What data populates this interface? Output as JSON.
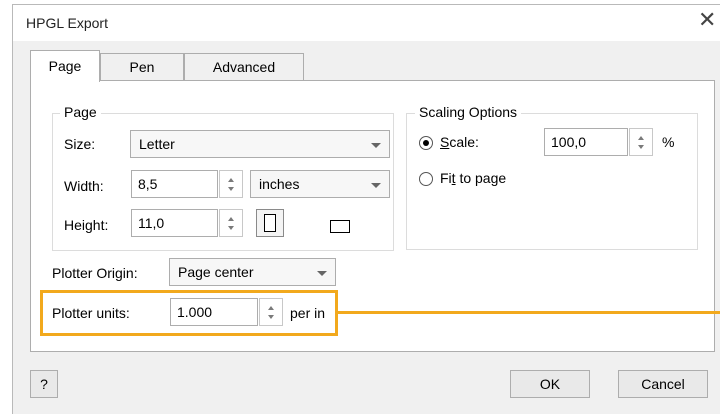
{
  "window": {
    "title": "HPGL Export",
    "close_glyph": "✕"
  },
  "tabs": [
    {
      "label": "Page",
      "active": true
    },
    {
      "label": "Pen",
      "active": false
    },
    {
      "label": "Advanced",
      "active": false
    }
  ],
  "page_group": {
    "title": "Page",
    "size_label": "Size:",
    "size_value": "Letter",
    "width_label": "Width:",
    "width_value": "8,5",
    "unit_value": "inches",
    "height_label": "Height:",
    "height_value": "11,0",
    "orientation": {
      "portrait_icon": "portrait-icon",
      "landscape_icon": "landscape-icon",
      "selected": "portrait"
    }
  },
  "scaling_group": {
    "title": "Scaling Options",
    "scale_label_key": "S",
    "scale_label_rest": "cale:",
    "scale_value": "100,0",
    "scale_unit": "%",
    "fit_label_pre": "Fi",
    "fit_label_key": "t",
    "fit_label_rest": " to page",
    "selected": "scale"
  },
  "plotter": {
    "origin_label": "Plotter Origin:",
    "origin_value": "Page center",
    "units_label": "Plotter units:",
    "units_value": "1.000",
    "units_suffix": "per in"
  },
  "footer": {
    "help_label": "?",
    "ok_label": "OK",
    "cancel_label": "Cancel"
  },
  "colors": {
    "highlight": "#f2a91d"
  }
}
